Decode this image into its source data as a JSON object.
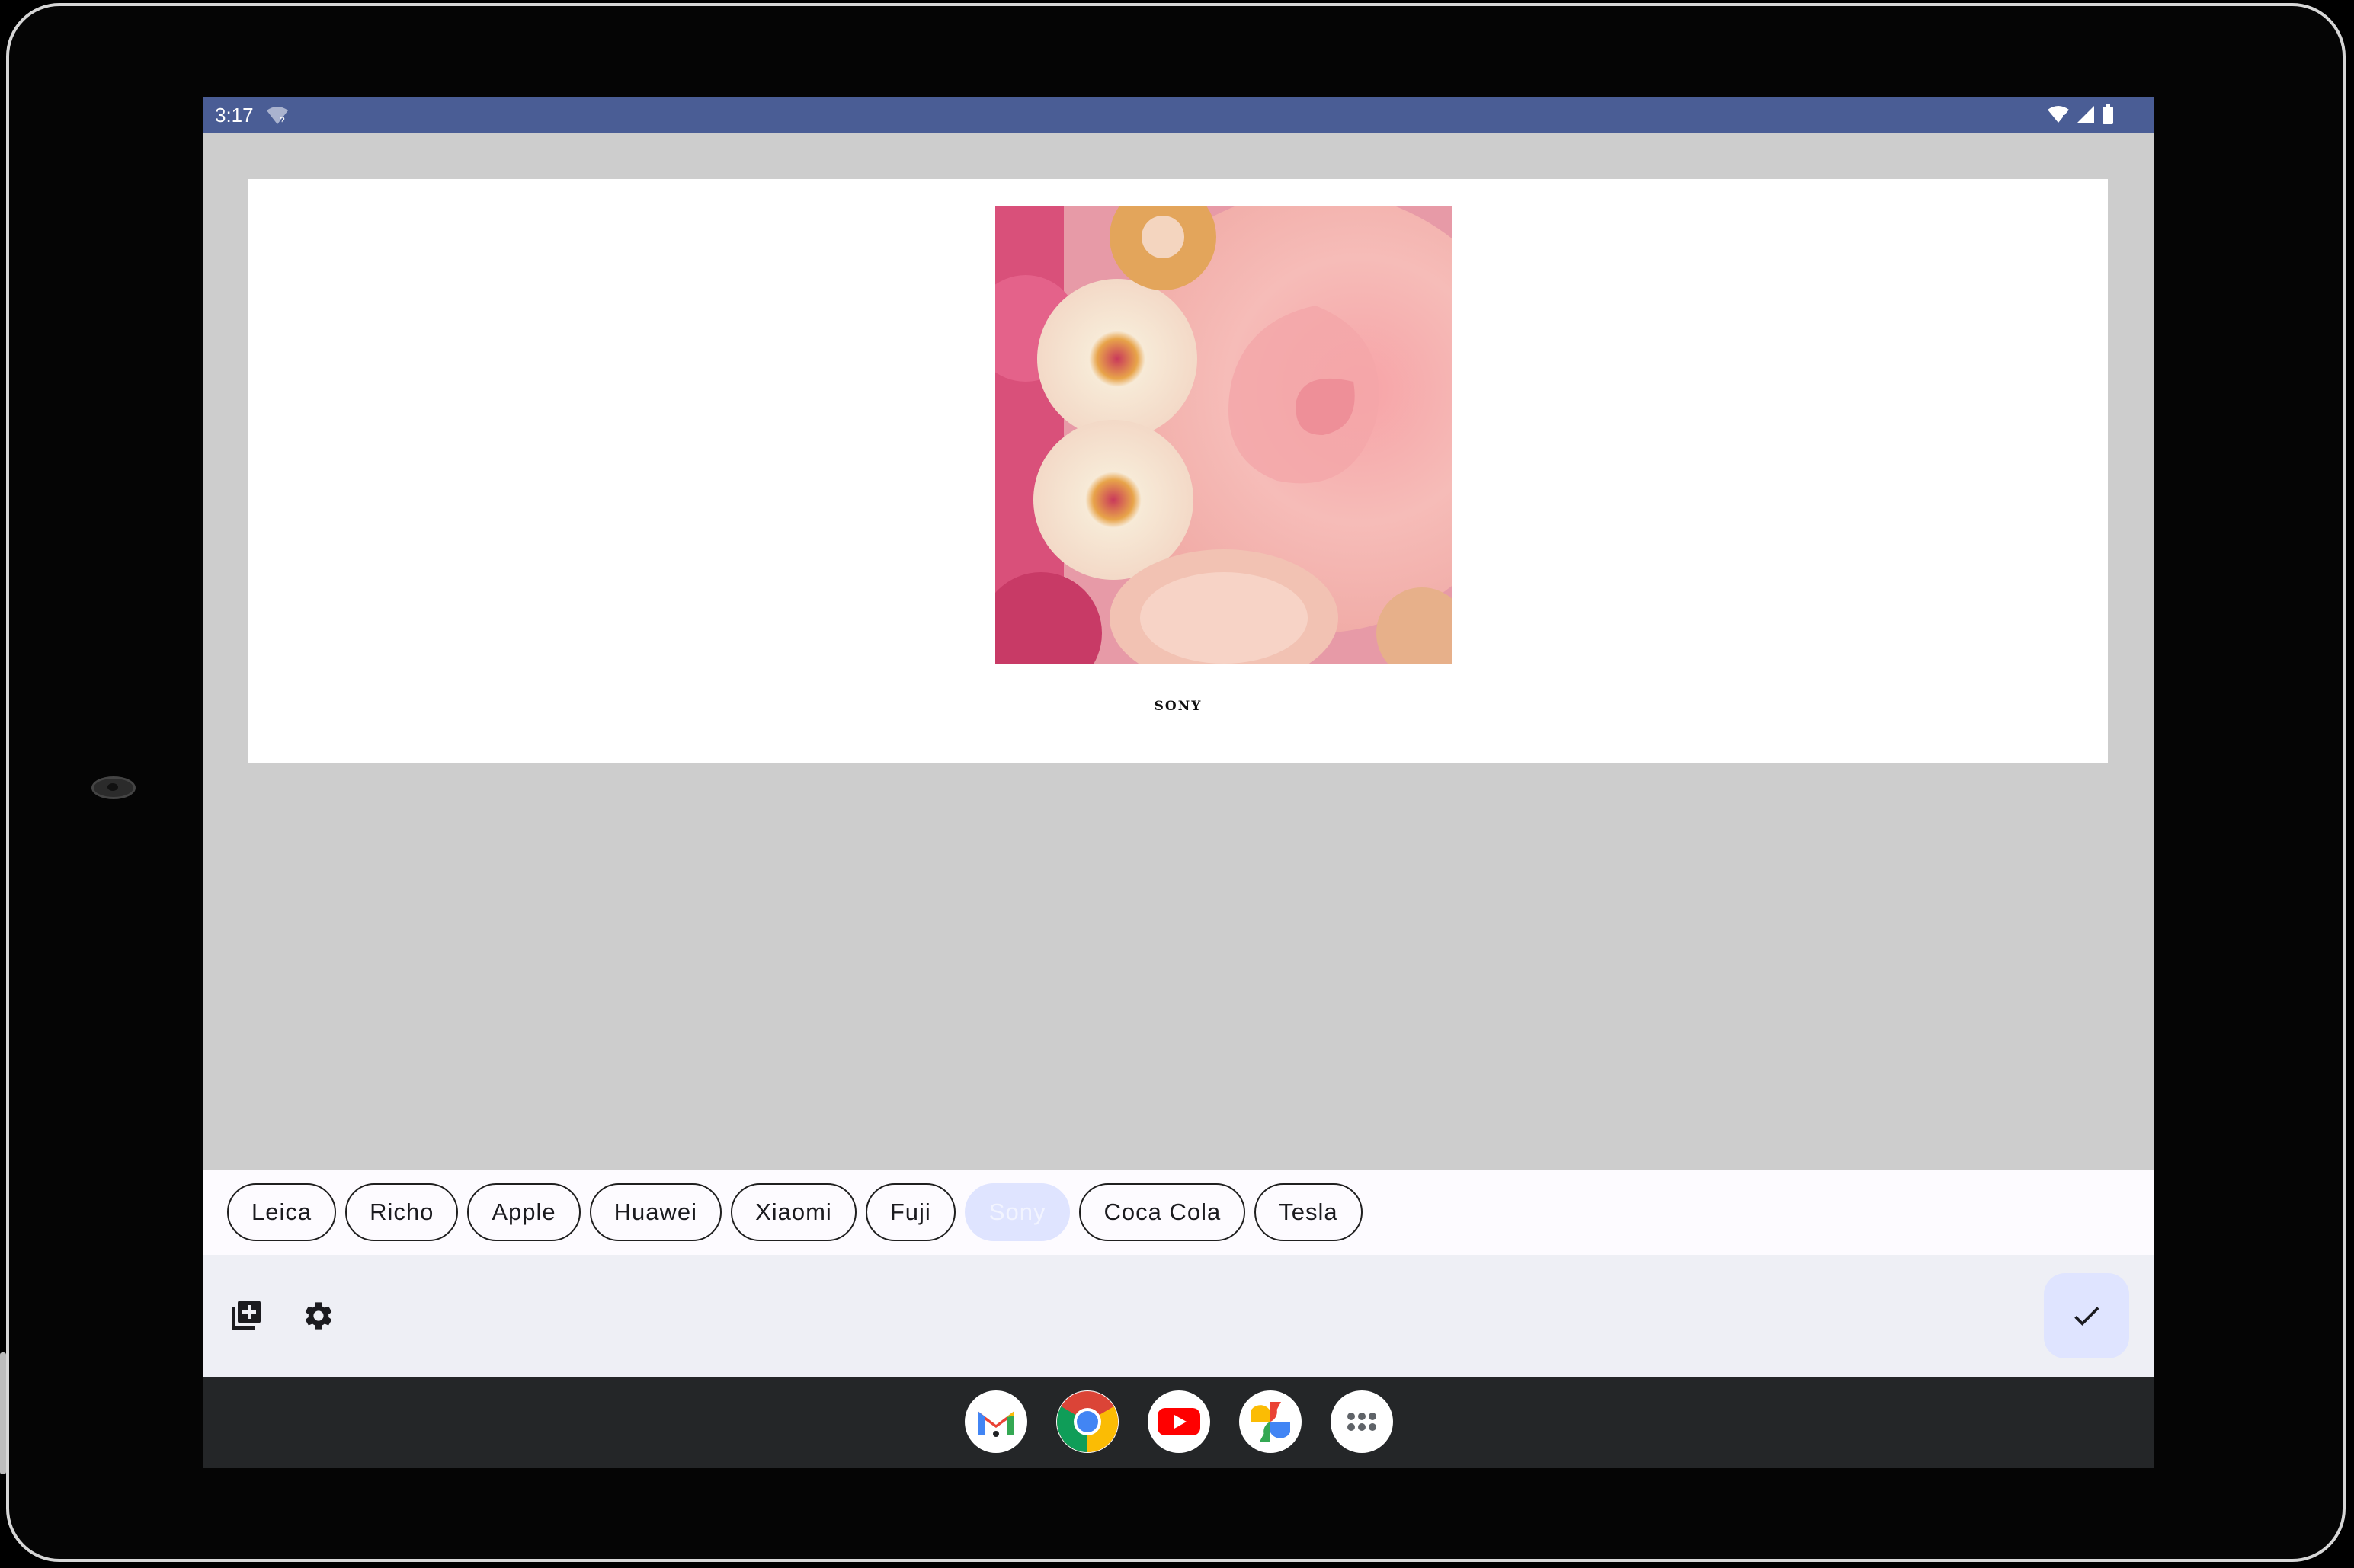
{
  "status_bar": {
    "time": "3:17"
  },
  "preview": {
    "brand_watermark": "SONY"
  },
  "brands": [
    {
      "label": "Leica",
      "selected": false
    },
    {
      "label": "Richo",
      "selected": false
    },
    {
      "label": "Apple",
      "selected": false
    },
    {
      "label": "Huawei",
      "selected": false
    },
    {
      "label": "Xiaomi",
      "selected": false
    },
    {
      "label": "Fuji",
      "selected": false
    },
    {
      "label": "Sony",
      "selected": true
    },
    {
      "label": "Coca Cola",
      "selected": false
    },
    {
      "label": "Tesla",
      "selected": false
    }
  ],
  "toolbar": {
    "icons": [
      "add-photo-icon",
      "settings-icon",
      "check-icon"
    ]
  },
  "dock": {
    "apps": [
      "gmail-icon",
      "chrome-icon",
      "youtube-icon",
      "photos-icon",
      "app-drawer-icon"
    ]
  },
  "colors": {
    "status_bar": "#4a5d95",
    "selected_chip": "#dfe4ff",
    "toolbar": "#eeeff5",
    "dock": "#242628"
  }
}
